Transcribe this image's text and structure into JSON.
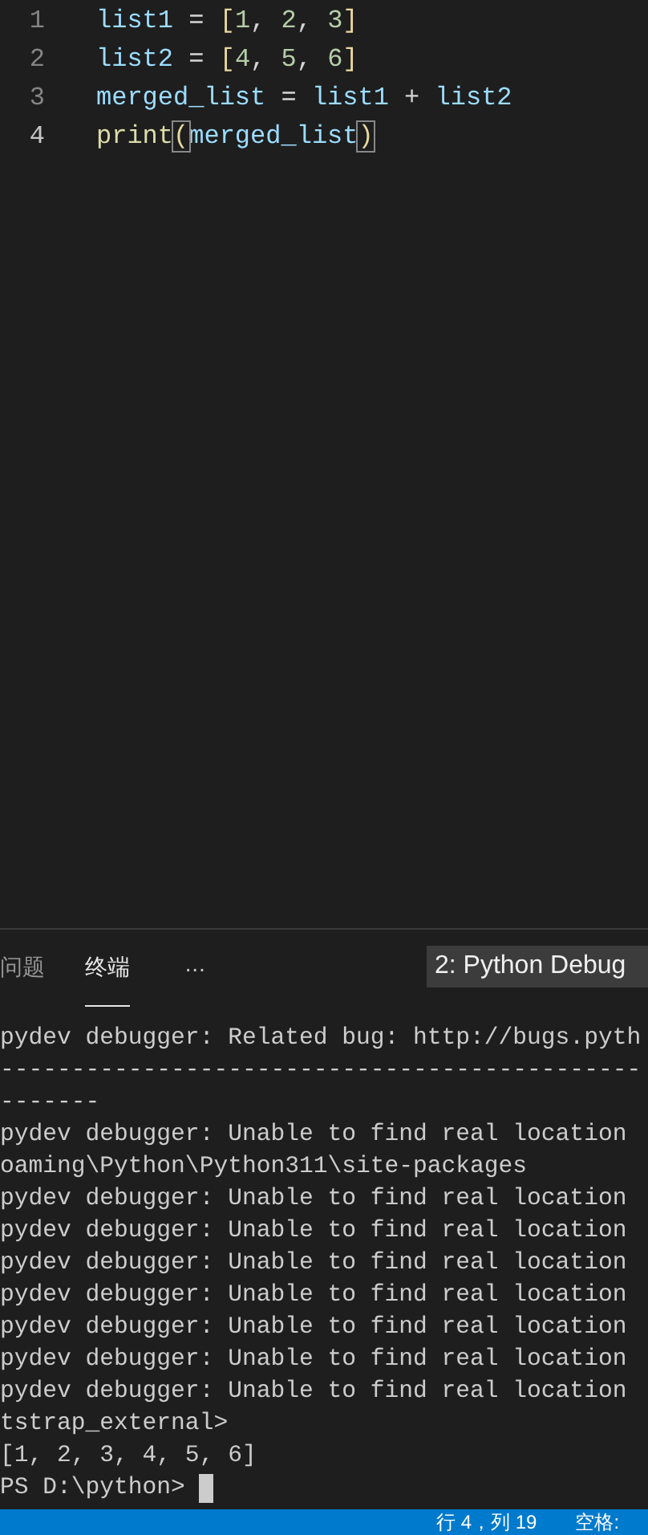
{
  "editor": {
    "lines": [
      {
        "number": "1",
        "current": false,
        "tokens": [
          {
            "kind": "var",
            "text": "list1"
          },
          {
            "kind": "op",
            "text": " = "
          },
          {
            "kind": "bracket",
            "text": "["
          },
          {
            "kind": "num",
            "text": "1"
          },
          {
            "kind": "op",
            "text": ", "
          },
          {
            "kind": "num",
            "text": "2"
          },
          {
            "kind": "op",
            "text": ", "
          },
          {
            "kind": "num",
            "text": "3"
          },
          {
            "kind": "bracket",
            "text": "]"
          }
        ]
      },
      {
        "number": "2",
        "current": false,
        "tokens": [
          {
            "kind": "var",
            "text": "list2"
          },
          {
            "kind": "op",
            "text": " = "
          },
          {
            "kind": "bracket",
            "text": "["
          },
          {
            "kind": "num",
            "text": "4"
          },
          {
            "kind": "op",
            "text": ", "
          },
          {
            "kind": "num",
            "text": "5"
          },
          {
            "kind": "op",
            "text": ", "
          },
          {
            "kind": "num",
            "text": "6"
          },
          {
            "kind": "bracket",
            "text": "]"
          }
        ]
      },
      {
        "number": "3",
        "current": false,
        "tokens": [
          {
            "kind": "var",
            "text": "merged_list"
          },
          {
            "kind": "op",
            "text": " = "
          },
          {
            "kind": "var",
            "text": "list1"
          },
          {
            "kind": "op",
            "text": " + "
          },
          {
            "kind": "var",
            "text": "list2"
          }
        ]
      },
      {
        "number": "4",
        "current": true,
        "tokens": [
          {
            "kind": "func",
            "text": "print"
          },
          {
            "kind": "match",
            "text": "("
          },
          {
            "kind": "var",
            "text": "merged_list"
          },
          {
            "kind": "match",
            "text": ")"
          }
        ]
      }
    ]
  },
  "panel": {
    "tabs": [
      {
        "label": "问题",
        "selected": false
      },
      {
        "label": "终端",
        "selected": true
      }
    ],
    "more": "···",
    "terminal_select": "2: Python Debug",
    "terminal_lines": [
      "pydev debugger: Related bug: http://bugs.pyth",
      "---------------------------------------------",
      "-------",
      "pydev debugger: Unable to find real location",
      "oaming\\Python\\Python311\\site-packages",
      "pydev debugger: Unable to find real location",
      "pydev debugger: Unable to find real location",
      "pydev debugger: Unable to find real location",
      "pydev debugger: Unable to find real location",
      "pydev debugger: Unable to find real location",
      "pydev debugger: Unable to find real location",
      "pydev debugger: Unable to find real location",
      "tstrap_external>",
      "[1, 2, 3, 4, 5, 6]",
      "PS D:\\python> "
    ]
  },
  "status_bar": {
    "items": [
      "行 4，列 19",
      "空格:"
    ]
  }
}
